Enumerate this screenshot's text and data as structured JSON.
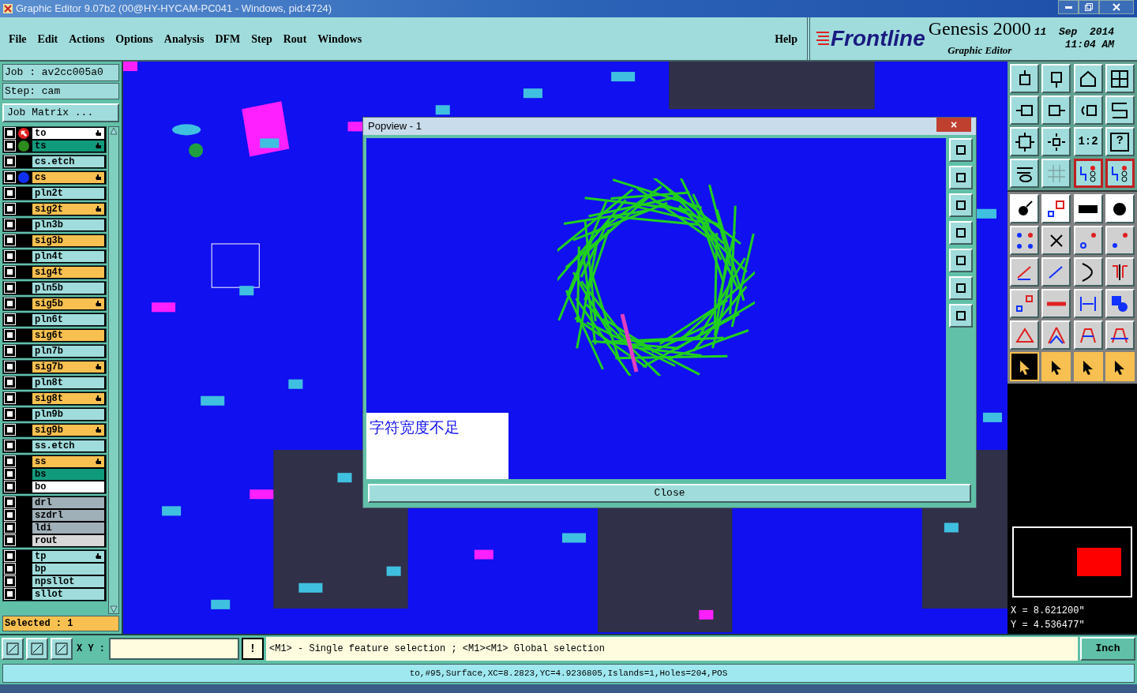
{
  "window": {
    "title": "Graphic Editor 9.07b2 (00@HY-HYCAM-PC041 - Windows, pid:4724)"
  },
  "menu": [
    "File",
    "Edit",
    "Actions",
    "Options",
    "Analysis",
    "DFM",
    "Step",
    "Rout",
    "Windows"
  ],
  "help": "Help",
  "brand": {
    "logo": "Frontline",
    "product": "Genesis 2000",
    "subtitle": "Graphic Editor",
    "date": "11  Sep  2014",
    "time": "11:04 AM"
  },
  "job": "Job : av2cc005a0",
  "step": "Step: cam",
  "job_matrix": "Job Matrix ...",
  "layer_groups": [
    {
      "layers": [
        {
          "name": "to",
          "color": "#ffffff",
          "checked": false,
          "work_layer": true,
          "affected": true
        },
        {
          "name": "ts",
          "color": "#109a7c",
          "checked": false,
          "work_layer": false,
          "dot": {
            "color": "#2e8b1e"
          },
          "affected": true
        }
      ]
    },
    {
      "layers": [
        {
          "name": "cs.etch",
          "color": "#a0dcdc",
          "checked": false,
          "work_layer": false,
          "affected": false
        }
      ]
    },
    {
      "layers": [
        {
          "name": "cs",
          "color": "#f8c050",
          "checked": false,
          "work_layer": false,
          "dot": {
            "color": "#1030ff"
          },
          "affected": true
        }
      ]
    },
    {
      "layers": [
        {
          "name": "pln2t",
          "color": "#a0dcdc",
          "checked": false,
          "work_layer": false,
          "affected": false
        }
      ]
    },
    {
      "layers": [
        {
          "name": "sig2t",
          "color": "#f8c050",
          "checked": false,
          "work_layer": false,
          "affected": true
        }
      ]
    },
    {
      "layers": [
        {
          "name": "pln3b",
          "color": "#a0dcdc",
          "checked": false,
          "work_layer": false,
          "affected": false
        }
      ]
    },
    {
      "layers": [
        {
          "name": "sig3b",
          "color": "#f8c050",
          "checked": false,
          "work_layer": false,
          "affected": false
        }
      ]
    },
    {
      "layers": [
        {
          "name": "pln4t",
          "color": "#a0dcdc",
          "checked": false,
          "work_layer": false,
          "affected": false
        }
      ]
    },
    {
      "layers": [
        {
          "name": "sig4t",
          "color": "#f8c050",
          "checked": false,
          "work_layer": false,
          "affected": false
        }
      ]
    },
    {
      "layers": [
        {
          "name": "pln5b",
          "color": "#a0dcdc",
          "checked": false,
          "work_layer": false,
          "affected": false
        }
      ]
    },
    {
      "layers": [
        {
          "name": "sig5b",
          "color": "#f8c050",
          "checked": false,
          "work_layer": false,
          "affected": true
        }
      ]
    },
    {
      "layers": [
        {
          "name": "pln6t",
          "color": "#a0dcdc",
          "checked": false,
          "work_layer": false,
          "affected": false
        }
      ]
    },
    {
      "layers": [
        {
          "name": "sig6t",
          "color": "#f8c050",
          "checked": false,
          "work_layer": false,
          "affected": false
        }
      ]
    },
    {
      "layers": [
        {
          "name": "pln7b",
          "color": "#a0dcdc",
          "checked": false,
          "work_layer": false,
          "affected": false
        }
      ]
    },
    {
      "layers": [
        {
          "name": "sig7b",
          "color": "#f8c050",
          "checked": false,
          "work_layer": false,
          "affected": true
        }
      ]
    },
    {
      "layers": [
        {
          "name": "pln8t",
          "color": "#a0dcdc",
          "checked": false,
          "work_layer": false,
          "affected": false
        }
      ]
    },
    {
      "layers": [
        {
          "name": "sig8t",
          "color": "#f8c050",
          "checked": false,
          "work_layer": false,
          "affected": true
        }
      ]
    },
    {
      "layers": [
        {
          "name": "pln9b",
          "color": "#a0dcdc",
          "checked": false,
          "work_layer": false,
          "affected": false
        }
      ]
    },
    {
      "layers": [
        {
          "name": "sig9b",
          "color": "#f8c050",
          "checked": false,
          "work_layer": false,
          "affected": true
        }
      ]
    },
    {
      "layers": [
        {
          "name": "ss.etch",
          "color": "#a0dcdc",
          "checked": false,
          "work_layer": false,
          "affected": false
        }
      ]
    },
    {
      "layers": [
        {
          "name": "ss",
          "color": "#f8c050",
          "checked": false,
          "work_layer": false,
          "affected": true
        },
        {
          "name": "bs",
          "color": "#109a7c",
          "checked": false,
          "work_layer": false,
          "affected": false
        },
        {
          "name": "bo",
          "color": "#ffffff",
          "checked": false,
          "work_layer": false,
          "affected": false
        }
      ]
    },
    {
      "layers": [
        {
          "name": "drl",
          "color": "#a0b0b8",
          "checked": false,
          "work_layer": false,
          "affected": false
        },
        {
          "name": "szdrl",
          "color": "#a0b0b8",
          "checked": false,
          "work_layer": false,
          "affected": false
        },
        {
          "name": "ldi",
          "color": "#a0b0b8",
          "checked": false,
          "work_layer": false,
          "affected": false
        },
        {
          "name": "rout",
          "color": "#d8d8d8",
          "checked": false,
          "work_layer": false,
          "affected": false
        }
      ]
    },
    {
      "layers": [
        {
          "name": "tp",
          "color": "#a0dcdc",
          "checked": false,
          "work_layer": false,
          "affected": true
        },
        {
          "name": "bp",
          "color": "#a0dcdc",
          "checked": false,
          "work_layer": false,
          "affected": false
        },
        {
          "name": "npsllot",
          "color": "#a0dcdc",
          "checked": false,
          "work_layer": false,
          "affected": false
        },
        {
          "name": "sllot",
          "color": "#a0dcdc",
          "checked": false,
          "work_layer": false,
          "affected": false
        }
      ]
    }
  ],
  "selected_count": "Selected : 1",
  "popview": {
    "title": "Popview - 1",
    "close_x": "×",
    "message": "字符宽度不足",
    "close_button": "Close"
  },
  "toolbar": {
    "ratio_label": "1:2",
    "help_label": "?",
    "layer_tools": [
      {
        "active": true
      },
      {
        "active": true
      }
    ],
    "select_tools": [
      {
        "selected": true
      },
      {
        "selected": false
      },
      {
        "selected": false
      },
      {
        "selected": false
      }
    ]
  },
  "coords": {
    "x": "X = 8.621200\"",
    "y": "Y = 4.536477\""
  },
  "bottom": {
    "xy_label": "X Y :",
    "bang": "!",
    "hint": "<M1> - Single feature selection ; <M1><M1> Global selection",
    "units": "Inch"
  },
  "status": "to,#95,Surface,XC=8.2823,YC=4.9236805,Islands=1,Holes=204,POS"
}
